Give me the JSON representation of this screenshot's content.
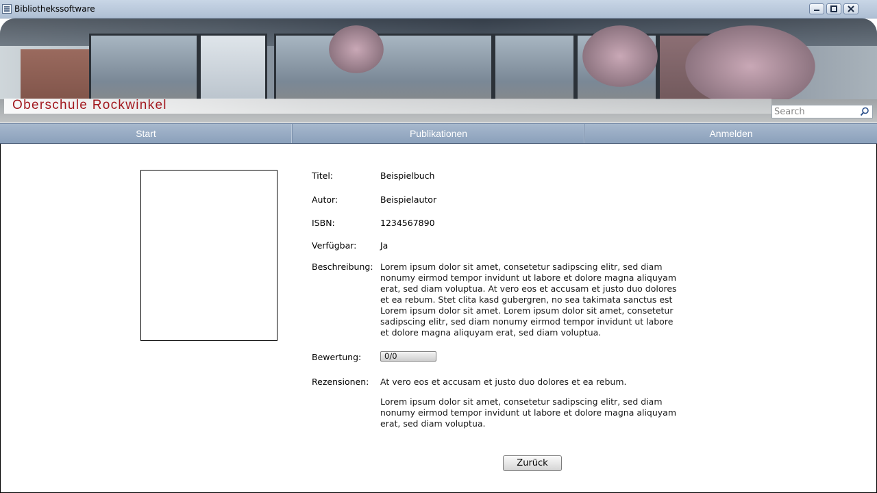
{
  "window": {
    "title": "Bibliothekssoftware",
    "controls": [
      "minimize-icon",
      "maximize-icon",
      "close-icon"
    ]
  },
  "banner": {
    "school_name": "Oberschule Rockwinkel",
    "search_placeholder": "Search"
  },
  "nav": {
    "items": [
      "Start",
      "Publikationen",
      "Anmelden"
    ]
  },
  "book": {
    "fields": {
      "title": {
        "label": "Titel:",
        "value": "Beispielbuch"
      },
      "author": {
        "label": "Autor:",
        "value": "Beispielautor"
      },
      "isbn": {
        "label": "ISBN:",
        "value": "1234567890"
      },
      "available": {
        "label": "Verfügbar:",
        "value": "Ja"
      },
      "description": {
        "label": "Beschreibung:",
        "value": "Lorem ipsum dolor sit amet, consetetur sadipscing elitr, sed diam nonumy eirmod tempor invidunt ut labore et dolore magna aliquyam erat, sed diam voluptua. At vero eos et accusam et justo duo dolores et ea rebum. Stet clita kasd gubergren, no sea takimata sanctus est Lorem ipsum dolor sit amet. Lorem ipsum dolor sit amet, consetetur sadipscing elitr, sed diam nonumy eirmod tempor invidunt ut labore et dolore magna aliquyam erat, sed diam voluptua."
      },
      "rating": {
        "label": "Bewertung:",
        "value": "0/0"
      },
      "reviews": {
        "label": "Rezensionen:",
        "items": [
          "At vero eos et accusam et justo duo dolores et ea rebum.",
          "Lorem ipsum dolor sit amet, consetetur sadipscing elitr, sed diam nonumy eirmod tempor invidunt ut labore et dolore magna aliquyam erat, sed diam voluptua."
        ]
      }
    }
  },
  "actions": {
    "back_label": "Zurück"
  }
}
